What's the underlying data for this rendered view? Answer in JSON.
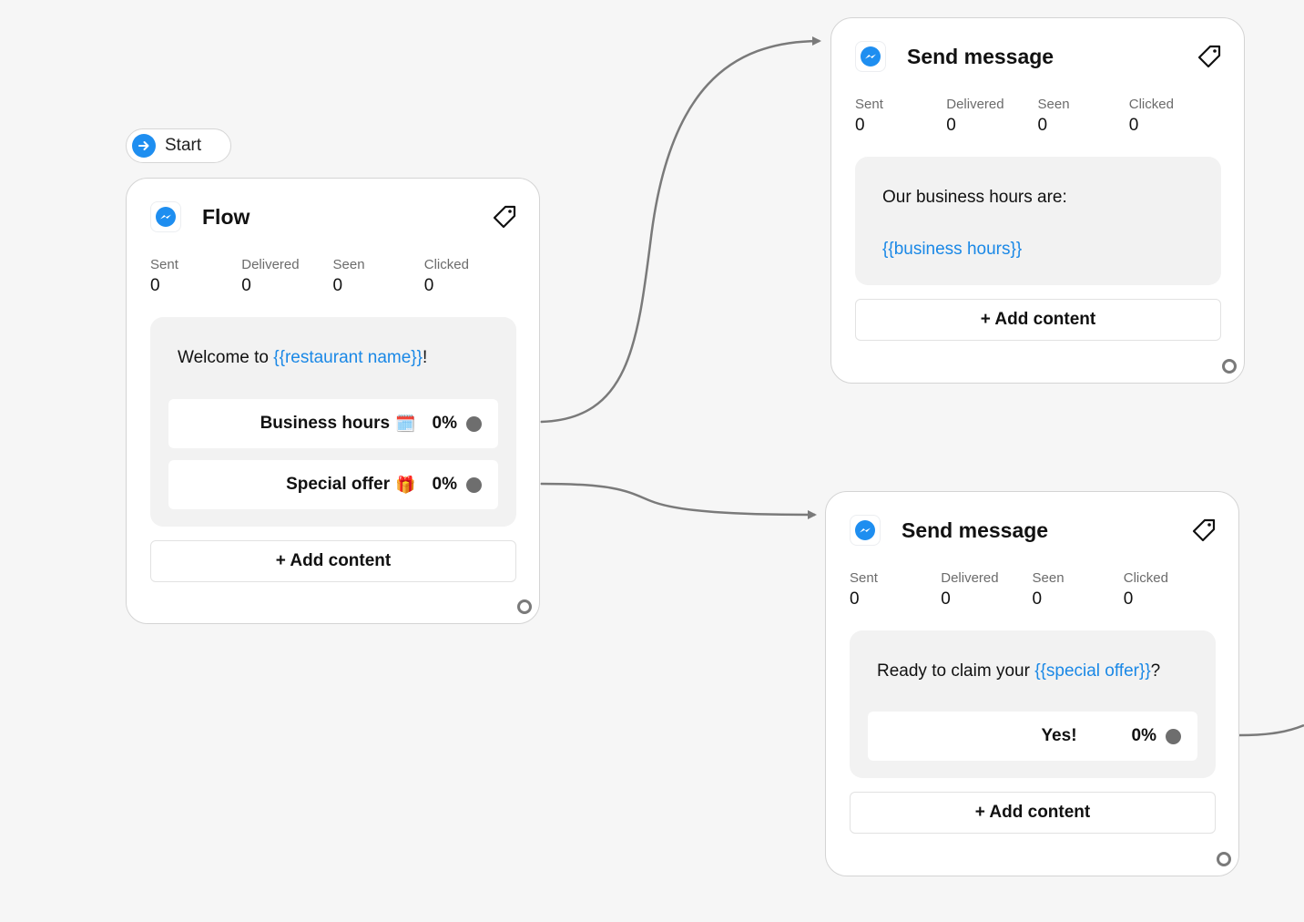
{
  "start": {
    "label": "Start"
  },
  "stat_labels": {
    "sent": "Sent",
    "delivered": "Delivered",
    "seen": "Seen",
    "clicked": "Clicked"
  },
  "flow_card": {
    "title": "Flow",
    "stats": {
      "sent": "0",
      "delivered": "0",
      "seen": "0",
      "clicked": "0"
    },
    "message": {
      "prefix": "Welcome to ",
      "variable": "{{restaurant name}}",
      "suffix": "!"
    },
    "buttons": [
      {
        "label": "Business hours",
        "emoji": "🗓️",
        "percent": "0%"
      },
      {
        "label": "Special offer",
        "emoji": "🎁",
        "percent": "0%"
      }
    ],
    "add_content": "+ Add content"
  },
  "send_card_1": {
    "title": "Send message",
    "stats": {
      "sent": "0",
      "delivered": "0",
      "seen": "0",
      "clicked": "0"
    },
    "message": {
      "line1": "Our business hours are:",
      "variable": "{{business hours}}"
    },
    "add_content": "+ Add content"
  },
  "send_card_2": {
    "title": "Send message",
    "stats": {
      "sent": "0",
      "delivered": "0",
      "seen": "0",
      "clicked": "0"
    },
    "message": {
      "prefix": "Ready to claim your ",
      "variable": "{{special offer}}",
      "suffix": "?"
    },
    "buttons": [
      {
        "label": "Yes!",
        "percent": "0%"
      }
    ],
    "add_content": "+ Add content"
  },
  "colors": {
    "accent": "#1e8ef0",
    "variable": "#1a88e6",
    "connector": "#7a7a7a",
    "canvas": "#f6f6f6"
  },
  "icons": {
    "start": "arrow-right-circle-icon",
    "messenger": "messenger-icon",
    "tag": "tag-icon",
    "handle": "output-handle-icon"
  }
}
